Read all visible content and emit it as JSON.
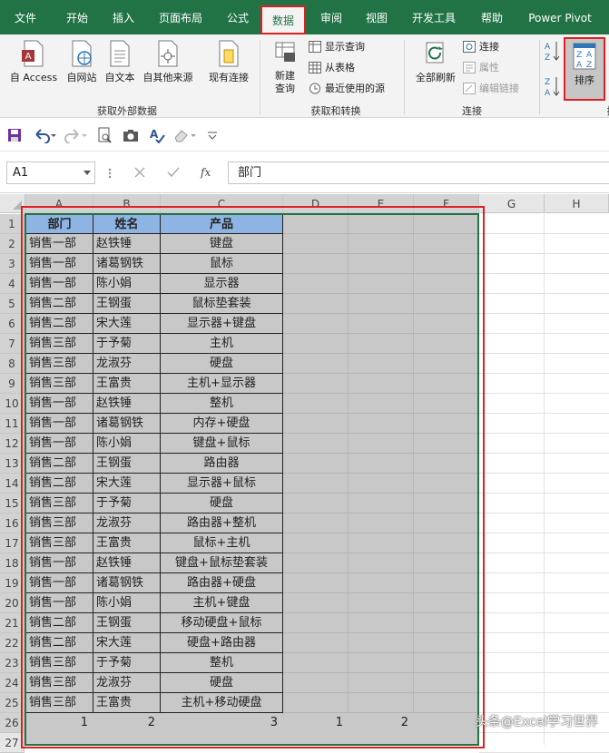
{
  "ribbon_tabs": [
    "文件",
    "开始",
    "插入",
    "页面布局",
    "公式",
    "数据",
    "审阅",
    "视图",
    "开发工具",
    "帮助",
    "Power Pivot"
  ],
  "active_tab": "数据",
  "groups": {
    "external": {
      "label": "获取外部数据",
      "buttons": [
        "自 Access",
        "自网站",
        "自文本",
        "自其他来源",
        "现有连接"
      ]
    },
    "transform": {
      "label": "获取和转换",
      "new_query": "新建\n查询",
      "show_query": "显示查询",
      "from_table": "从表格",
      "recent_sources": "最近使用的源"
    },
    "connections": {
      "label": "连接",
      "refresh_all": "全部刷新",
      "connections": "连接",
      "properties": "属性",
      "edit_links": "编辑链接"
    },
    "sort": {
      "label": "排序",
      "sort_btn": "排序",
      "group_label": "排"
    }
  },
  "namebox": "A1",
  "formula": "部门",
  "columns": [
    "A",
    "B",
    "C",
    "D",
    "E",
    "F",
    "G",
    "H"
  ],
  "rows": [
    "1",
    "2",
    "3",
    "4",
    "5",
    "6",
    "7",
    "8",
    "9",
    "10",
    "11",
    "12",
    "13",
    "14",
    "15",
    "16",
    "17",
    "18",
    "19",
    "20",
    "21",
    "22",
    "23",
    "24",
    "25",
    "26",
    "27"
  ],
  "table_header": [
    "部门",
    "姓名",
    "产品"
  ],
  "table_rows": [
    [
      "销售一部",
      "赵铁锤",
      "键盘"
    ],
    [
      "销售一部",
      "诸葛钢铁",
      "鼠标"
    ],
    [
      "销售一部",
      "陈小娟",
      "显示器"
    ],
    [
      "销售二部",
      "王钢蛋",
      "鼠标垫套装"
    ],
    [
      "销售二部",
      "宋大莲",
      "显示器+键盘"
    ],
    [
      "销售三部",
      "于予菊",
      "主机"
    ],
    [
      "销售三部",
      "龙淑芬",
      "硬盘"
    ],
    [
      "销售三部",
      "王富贵",
      "主机+显示器"
    ],
    [
      "销售一部",
      "赵铁锤",
      "整机"
    ],
    [
      "销售一部",
      "诸葛钢铁",
      "内存+硬盘"
    ],
    [
      "销售一部",
      "陈小娟",
      "键盘+鼠标"
    ],
    [
      "销售二部",
      "王钢蛋",
      "路由器"
    ],
    [
      "销售二部",
      "宋大莲",
      "显示器+鼠标"
    ],
    [
      "销售三部",
      "于予菊",
      "硬盘"
    ],
    [
      "销售三部",
      "龙淑芬",
      "路由器+整机"
    ],
    [
      "销售三部",
      "王富贵",
      "鼠标+主机"
    ],
    [
      "销售一部",
      "赵铁锤",
      "键盘+鼠标垫套装"
    ],
    [
      "销售一部",
      "诸葛钢铁",
      "路由器+硬盘"
    ],
    [
      "销售一部",
      "陈小娟",
      "主机+键盘"
    ],
    [
      "销售二部",
      "王钢蛋",
      "移动硬盘+鼠标"
    ],
    [
      "销售二部",
      "宋大莲",
      "硬盘+路由器"
    ],
    [
      "销售三部",
      "于予菊",
      "整机"
    ],
    [
      "销售三部",
      "龙淑芬",
      "硬盘"
    ],
    [
      "销售三部",
      "王富贵",
      "主机+移动硬盘"
    ]
  ],
  "helper_row": [
    "1",
    "2",
    "3",
    "1",
    "2",
    ""
  ],
  "watermark": "头条@Excel学习世界",
  "colors": {
    "excel_green": "#217346",
    "header_fill": "#8eb4e3",
    "selection": "#c8c8c8",
    "highlight_red": "#e02020"
  }
}
